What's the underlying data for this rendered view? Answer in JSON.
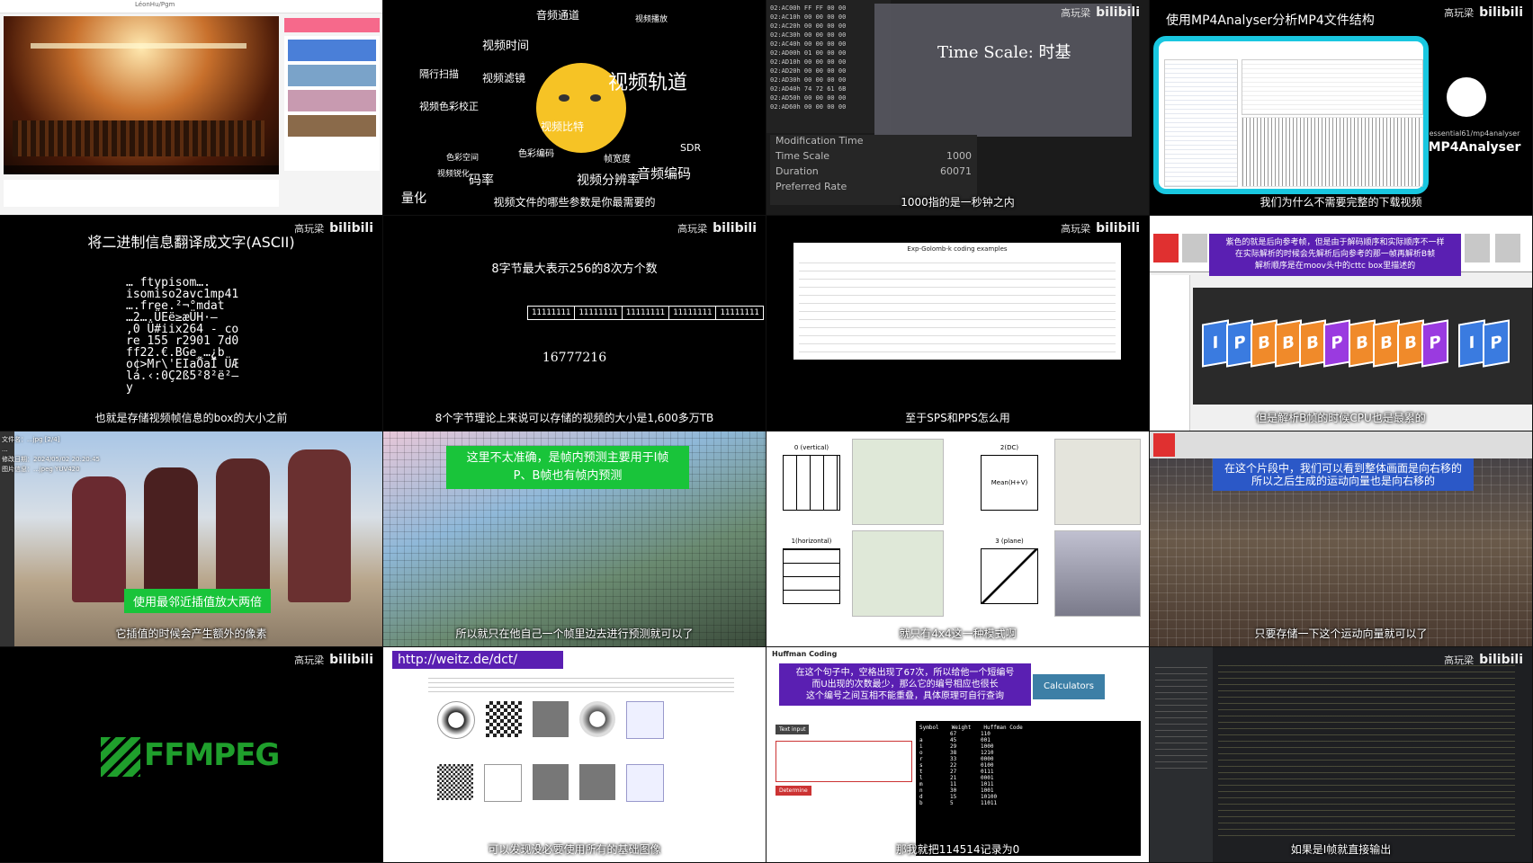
{
  "watermark": {
    "author": "高玩梁",
    "site": "bilibili"
  },
  "tiles": {
    "t1": {
      "subtitle": "",
      "browser_title": "LéonHu/Pgm"
    },
    "t2": {
      "words": [
        "视频轨道",
        "SDR",
        "音频编码",
        "视频滤镜",
        "色彩编码",
        "帧宽度",
        "视频分辨率",
        "码率",
        "隔行扫描",
        "视频色彩校正",
        "视频比特",
        "音频通道",
        "视频播放",
        "视频锐化",
        "量化",
        "色彩空间",
        "视频时间"
      ],
      "subtitle": "视频文件的哪些参数是你最需要的"
    },
    "t3": {
      "title": "Time Scale: 时基",
      "rows": [
        {
          "label": "Modification Time",
          "value": ""
        },
        {
          "label": "Time Scale",
          "value": "1000"
        },
        {
          "label": "Duration",
          "value": "60071"
        },
        {
          "label": "Preferred Rate",
          "value": ""
        }
      ],
      "subtitle": "1000指的是一秒钟之内"
    },
    "t4": {
      "title": "使用MP4Analyser分析MP4文件结构",
      "logo_caption": "essential61/mp4analyser",
      "logo_name": "MP4Analyser",
      "subtitle": "我们为什么不需要完整的下载视频"
    },
    "t5": {
      "title": "将二进制信息翻译成文字(ASCII)",
      "lines": [
        "… ftypisom….",
        "isomiso2avc1mp41",
        "….free.²¬°mdat",
        "…2….ÜEë≥æÜH·–",
        ",0 Ü#iix264 - co",
        "re 155 r2901 7d0",
        "ff22.€.BGe_…¿b",
        "o¢>Mr\\'EIaÕaÏ ÜÆ",
        "lá.‹:0Ç2ß5²8²ë²–",
        "y"
      ],
      "subtitle": "也就是存储视频帧信息的box的大小之前"
    },
    "t6": {
      "heading": "8字节最大表示256的8次方个数",
      "cells": [
        "11111111",
        "11111111",
        "11111111",
        "11111111",
        "11111111"
      ],
      "number": "16777216",
      "subtitle": "8个字节理论上来说可以存储的视频的大小是1,600多万TB"
    },
    "t7": {
      "table_title": "Exp-Golomb-k coding examples",
      "subtitle": "至于SPS和PPS怎么用"
    },
    "t8": {
      "caption": [
        "紫色的就是后向参考帧，但是由于解码顺序和实际顺序不一样",
        "在实际解析的时候会先解析后向参考的那一帧再解析B帧",
        "解析顺序是在moov头中的cttc box里描述的"
      ],
      "frames": [
        "I",
        "P",
        "B",
        "B",
        "B",
        "P",
        "B",
        "B",
        "B",
        "P",
        "I",
        "P"
      ],
      "subtitle": "但是解析B帧的时候CPU也是最累的"
    },
    "t9": {
      "info": [
        "文件名：...jpg [2/4]",
        "...",
        "修改日期：2024/05/02 20:20:45",
        "图片信息：...jpeg YUV420"
      ],
      "caption": "使用最邻近插值放大两倍",
      "subtitle": "它插值的时候会产生额外的像素"
    },
    "t10": {
      "caption": [
        "这里不太准确，是帧内预测主要用于I帧",
        "P、B帧也有帧内预测"
      ],
      "subtitle": "所以就只在他自己一个帧里边去进行预测就可以了"
    },
    "t11": {
      "modes": [
        "0 (vertical)",
        "2(DC)",
        "1(horizontal)",
        "3 (plane)"
      ],
      "dc_label": "Mean(H+V)",
      "subtitle": "就只有4x4这一种模式啊"
    },
    "t12": {
      "caption": [
        "在这个片段中，我们可以看到整体画面是向右移的",
        "所以之后生成的运动向量也是向右移的"
      ],
      "subtitle": "只要存储一下这个运动向量就可以了"
    },
    "t13": {
      "logo": "FFMPEG"
    },
    "t14": {
      "url": "http://weitz.de/dct/",
      "subtitle": "可以发现没必要使用所有的基础图像"
    },
    "t15": {
      "heading": "Huffman Coding",
      "caption": [
        "在这个句子中，空格出现了67次，所以给他一个短编号",
        "而U出现的次数最少，那么它的编号相应也很长",
        "这个编号之间互相不能重叠，具体原理可自行查询"
      ],
      "brand": "Calculators",
      "table_header": [
        "Symbol",
        "Weight",
        "Huffman Code"
      ],
      "table_rows": [
        [
          "",
          "67",
          "110"
        ],
        [
          "a",
          "45",
          "001"
        ],
        [
          "i",
          "29",
          "1000"
        ],
        [
          "o",
          "38",
          "1210"
        ],
        [
          "r",
          "33",
          "0000"
        ],
        [
          "s",
          "22",
          "0100"
        ],
        [
          "t",
          "27",
          "0111"
        ],
        [
          "l",
          "21",
          "0001"
        ],
        [
          "m",
          "11",
          "1011"
        ],
        [
          "n",
          "30",
          "1001"
        ],
        [
          "d",
          "15",
          "10100"
        ],
        [
          "b",
          "5",
          "11011"
        ]
      ],
      "buttons": [
        "Text input",
        "Determine"
      ],
      "subtitle": "那我就把114514记录为0"
    },
    "t16": {
      "subtitle": "如果是I帧就直接输出"
    }
  },
  "colors": {
    "accent_blue": "#2b58c7",
    "accent_purple": "#5a1fb2",
    "accent_green": "#19c43a",
    "ffmpeg_green": "#1f9f2c"
  }
}
